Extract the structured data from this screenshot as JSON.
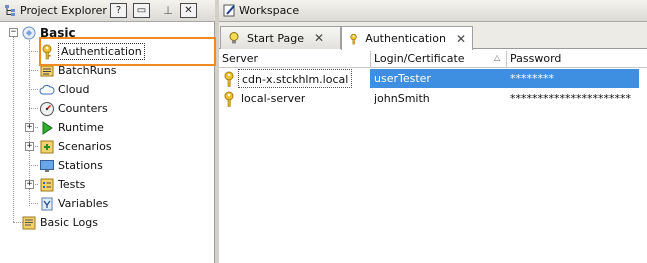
{
  "project_explorer": {
    "title": "Project Explorer",
    "buttons": {
      "help": "?",
      "minimize": "▭",
      "pin": "⊥",
      "close": "✕"
    },
    "tree": {
      "root": "Basic",
      "items": [
        {
          "label": "Authentication",
          "icon": "key-icon"
        },
        {
          "label": "BatchRuns",
          "icon": "batch-icon"
        },
        {
          "label": "Cloud",
          "icon": "cloud-icon"
        },
        {
          "label": "Counters",
          "icon": "gauge-icon"
        },
        {
          "label": "Runtime",
          "icon": "play-icon"
        },
        {
          "label": "Scenarios",
          "icon": "scenario-icon"
        },
        {
          "label": "Stations",
          "icon": "monitor-icon"
        },
        {
          "label": "Tests",
          "icon": "tests-icon"
        },
        {
          "label": "Variables",
          "icon": "variables-icon"
        }
      ],
      "logs": "Basic Logs"
    }
  },
  "workspace": {
    "title": "Workspace",
    "tabs": [
      {
        "label": "Start Page",
        "close": "✕"
      },
      {
        "label": "Authentication",
        "close": "✕"
      }
    ],
    "grid": {
      "columns": [
        "Server",
        "Login/Certificate",
        "Password"
      ],
      "rows": [
        {
          "server": "cdn-x.stckhlm.local",
          "login": "userTester",
          "password": "********"
        },
        {
          "server": "local-server",
          "login": "johnSmith",
          "password": "**********************"
        }
      ]
    }
  },
  "colors": {
    "selection": "#3e8ee2",
    "highlight_outline": "#f0891e"
  }
}
